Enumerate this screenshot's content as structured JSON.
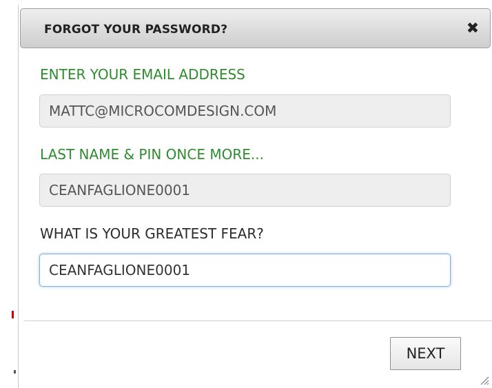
{
  "dialog": {
    "title": "FORGOT YOUR PASSWORD?",
    "close_icon": "close-icon",
    "close_glyph": "✖"
  },
  "form": {
    "email": {
      "label": "ENTER YOUR EMAIL ADDRESS",
      "value": "MATTC@MICROCOMDESIGN.COM"
    },
    "lastname_pin": {
      "label": "LAST NAME & PIN ONCE MORE...",
      "value": "CEANFAGLIONE0001"
    },
    "greatest_fear": {
      "label": "WHAT IS YOUR GREATEST FEAR?",
      "value": "CEANFAGLIONE0001"
    }
  },
  "footer": {
    "next_label": "NEXT"
  },
  "colors": {
    "label_green": "#2e8b2e",
    "focus_border": "#7fb0dd",
    "readonly_bg": "#eeeeee"
  }
}
